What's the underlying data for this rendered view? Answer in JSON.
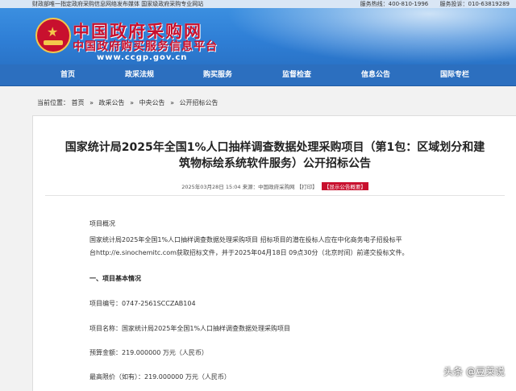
{
  "topbar": {
    "left_text": "财政部唯一指定政府采购信息网络发布媒体 国家级政府采购专业网站",
    "service_label": "服务热线：",
    "service_phone": "400-810-1996",
    "complaint_label": "服务投诉：",
    "complaint_phone": "010-63819289"
  },
  "header": {
    "site_name": "中国政府采购网",
    "site_subtitle": "中国政府购买服务信息平台",
    "site_url": "www.ccgp.gov.cn"
  },
  "nav": {
    "items": [
      "首页",
      "政采法规",
      "购买服务",
      "监督检查",
      "信息公告",
      "国际专栏"
    ]
  },
  "breadcrumb": {
    "prefix": "当前位置：",
    "items": [
      "首页",
      "政采公告",
      "中央公告",
      "公开招标公告"
    ],
    "separator": "»"
  },
  "article": {
    "title_line1": "国家统计局2025年全国1%人口抽样调查数据处理采购项目（第1包：区域划分和建",
    "title_line2": "筑物标绘系统软件服务）公开招标公告",
    "meta_date": "2025年03月28日 15:04",
    "meta_source": "来源：中国政府采购网",
    "print_label": "【打印】",
    "summary_label": "【显示公告概要】",
    "overview_heading": "项目概况",
    "overview_line1": "国家统计局2025年全国1%人口抽样调查数据处理采购项目 招标项目的潜在投标人应在中化商务电子招投标平",
    "overview_line2": "台http://e.sinochemitc.com获取招标文件，并于2025年04月18日 09点30分（北京时间）前递交投标文件。",
    "section1": "一、项目基本情况",
    "project_no": "项目编号：0747-2561SCCZAB104",
    "project_name": "项目名称：国家统计局2025年全国1%人口抽样调查数据处理采购项目",
    "budget": "预算金额：219.000000 万元（人民币）",
    "max_price": "最高限价（如有）：219.000000 万元（人民币）"
  },
  "watermark": "头条 @豆莱说",
  "colors": {
    "nav_bg": "#2c6fbf",
    "brand_red": "#c8102e"
  }
}
